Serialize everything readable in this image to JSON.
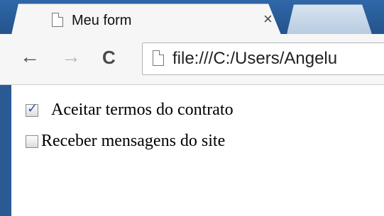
{
  "tab": {
    "title": "Meu form",
    "close": "×"
  },
  "toolbar": {
    "back": "←",
    "forward": "→",
    "reload": "C",
    "address": "file:///C:/Users/Angelu"
  },
  "form": {
    "items": [
      {
        "label": "Aceitar termos do contrato",
        "checked": true
      },
      {
        "label": "Receber mensagens do site",
        "checked": false
      }
    ]
  }
}
